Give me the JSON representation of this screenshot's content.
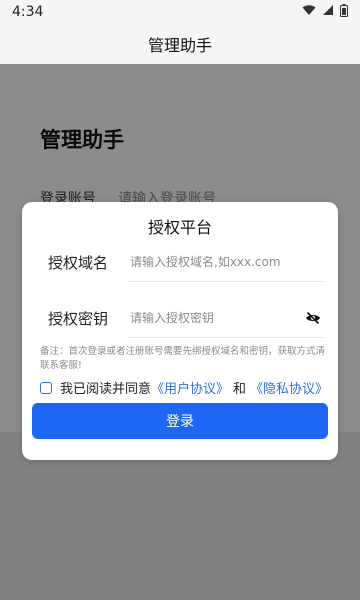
{
  "status_bar": {
    "time": "4:34"
  },
  "header": {
    "title": "管理助手"
  },
  "background_page": {
    "title": "管理助手",
    "account_label": "登录账号",
    "account_placeholder": "请输入登录账号"
  },
  "dialog": {
    "title": "授权平台",
    "domain_label": "授权域名",
    "domain_placeholder": "请输入授权域名,如xxx.com",
    "key_label": "授权密钥",
    "key_placeholder": "请输入授权密钥",
    "note": "备注：首次登录或者注册账号需要先绑授权域名和密钥，获取方式清联系客服!",
    "agree_text": "我已阅读并同意",
    "user_agreement": "《用户协议》",
    "and_text": "和",
    "privacy_agreement": "《隐私协议》",
    "login_button": "登录"
  },
  "icons": {
    "wifi": "wifi-icon",
    "signal": "signal-icon",
    "battery": "battery-icon",
    "eye_off": "eye-off-icon"
  }
}
